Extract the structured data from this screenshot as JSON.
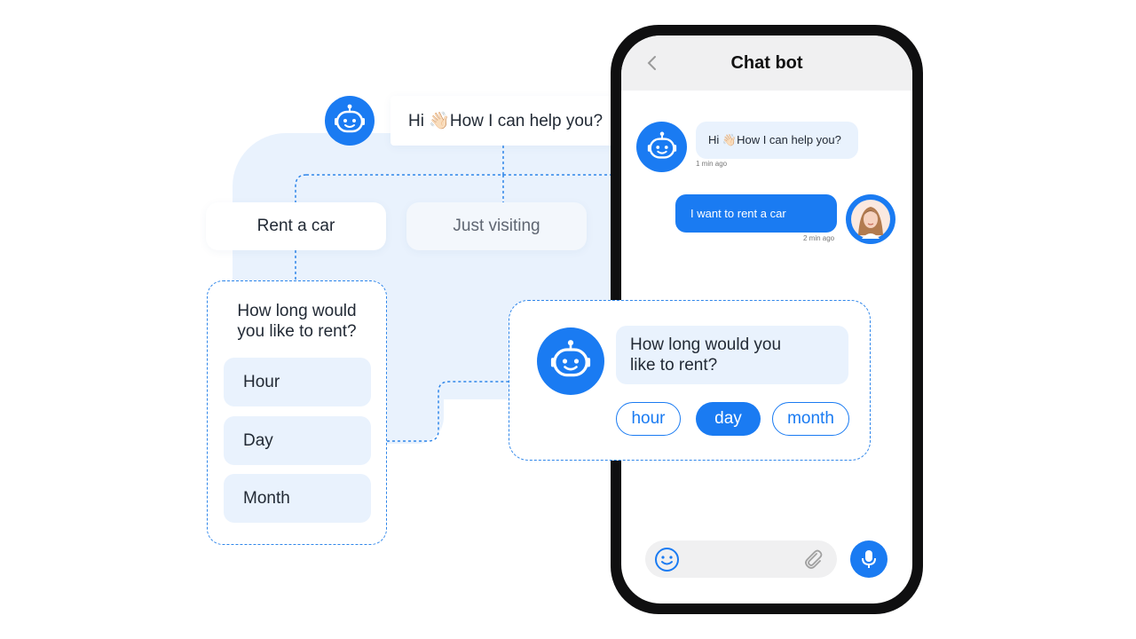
{
  "flow": {
    "greeting": "Hi 👋🏻How I can help you?",
    "options": [
      "Rent a car",
      "Just visiting"
    ],
    "question": "How long would you like to rent?",
    "durations": [
      "Hour",
      "Day",
      "Month"
    ]
  },
  "phone": {
    "title": "Chat bot",
    "messages": [
      {
        "from": "bot",
        "text": "Hi 👋🏻How I can help you?",
        "time": "1 min ago"
      },
      {
        "from": "user",
        "text": "I want to rent a car",
        "time": "2 min ago"
      }
    ],
    "input_icons": {
      "emoji": "smiley-icon",
      "attach": "paperclip-icon",
      "mic": "microphone-icon"
    }
  },
  "overlay": {
    "question": "How long would you like to rent?",
    "chips": [
      {
        "label": "hour",
        "selected": false
      },
      {
        "label": "day",
        "selected": true
      },
      {
        "label": "month",
        "selected": false
      }
    ]
  },
  "colors": {
    "accent": "#1a7bf2",
    "light_accent": "#e9f2fd",
    "phone_frame": "#0f0f10"
  }
}
